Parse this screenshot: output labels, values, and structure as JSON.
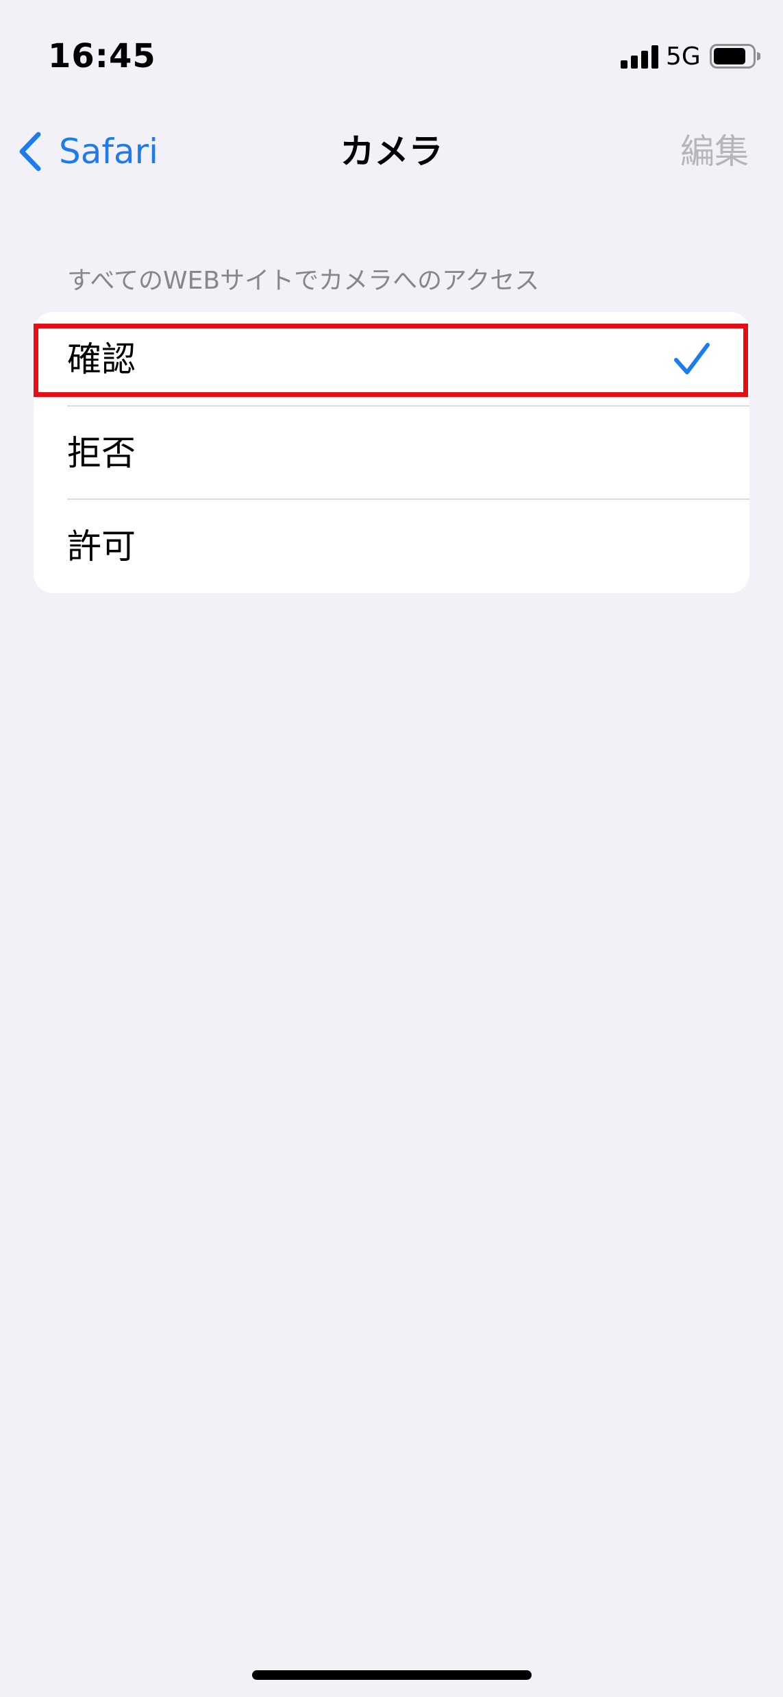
{
  "status_bar": {
    "time": "16:45",
    "network": "5G",
    "signal_icon": "cellular-signal-icon",
    "battery_icon": "battery-icon"
  },
  "nav": {
    "back_label": "Safari",
    "back_icon": "chevron-left-icon",
    "title": "カメラ",
    "edit_label": "編集"
  },
  "section": {
    "header": "すべてのWEBサイトでカメラへのアクセス",
    "options": [
      {
        "label": "確認",
        "selected": true
      },
      {
        "label": "拒否",
        "selected": false
      },
      {
        "label": "許可",
        "selected": false
      }
    ],
    "check_icon": "checkmark-icon"
  },
  "colors": {
    "accent": "#1d7bf0",
    "background": "#f2f1f7",
    "disabled_text": "#b5b5ba",
    "highlight": "#e60d14"
  }
}
